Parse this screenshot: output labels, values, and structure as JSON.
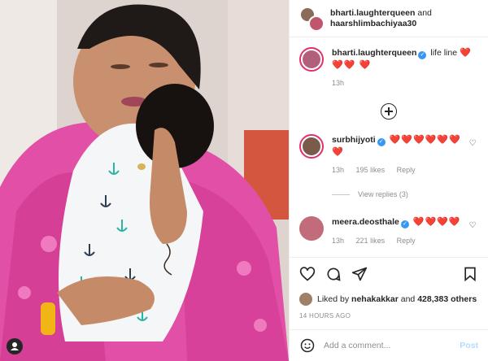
{
  "post": {
    "header": {
      "user1": "bharti.laughterqueen",
      "and": "and",
      "user2": "haarshlimbachiyaa30"
    },
    "caption": {
      "username": "bharti.laughterqueen",
      "text": "life line",
      "hearts": "❤️❤️❤️ ❤️",
      "time": "13h"
    },
    "comments": [
      {
        "username": "surbhijyoti",
        "hearts": "❤️❤️❤️❤️❤️❤️❤️",
        "time": "13h",
        "likes": "195 likes",
        "reply": "Reply",
        "view_replies": "View replies (3)"
      },
      {
        "username": "meera.deosthale",
        "hearts": "❤️❤️❤️❤️",
        "time": "13h",
        "likes": "221 likes",
        "reply": "Reply"
      }
    ],
    "liked_by": {
      "prefix": "Liked by",
      "user": "nehakakkar",
      "and": "and",
      "others": "428,383 others"
    },
    "timestamp": "14 HOURS AGO",
    "add_comment": {
      "placeholder": "Add a comment...",
      "post": "Post"
    }
  },
  "icons": [
    "heart-icon",
    "comment-icon",
    "share-icon",
    "bookmark-icon",
    "emoji-icon",
    "add-icon",
    "tag-user-icon"
  ],
  "colors": {
    "accent": "#3897f0",
    "heart": "#ed1c24",
    "meta": "#8e8e8e",
    "post_disabled": "#b3dbff"
  }
}
